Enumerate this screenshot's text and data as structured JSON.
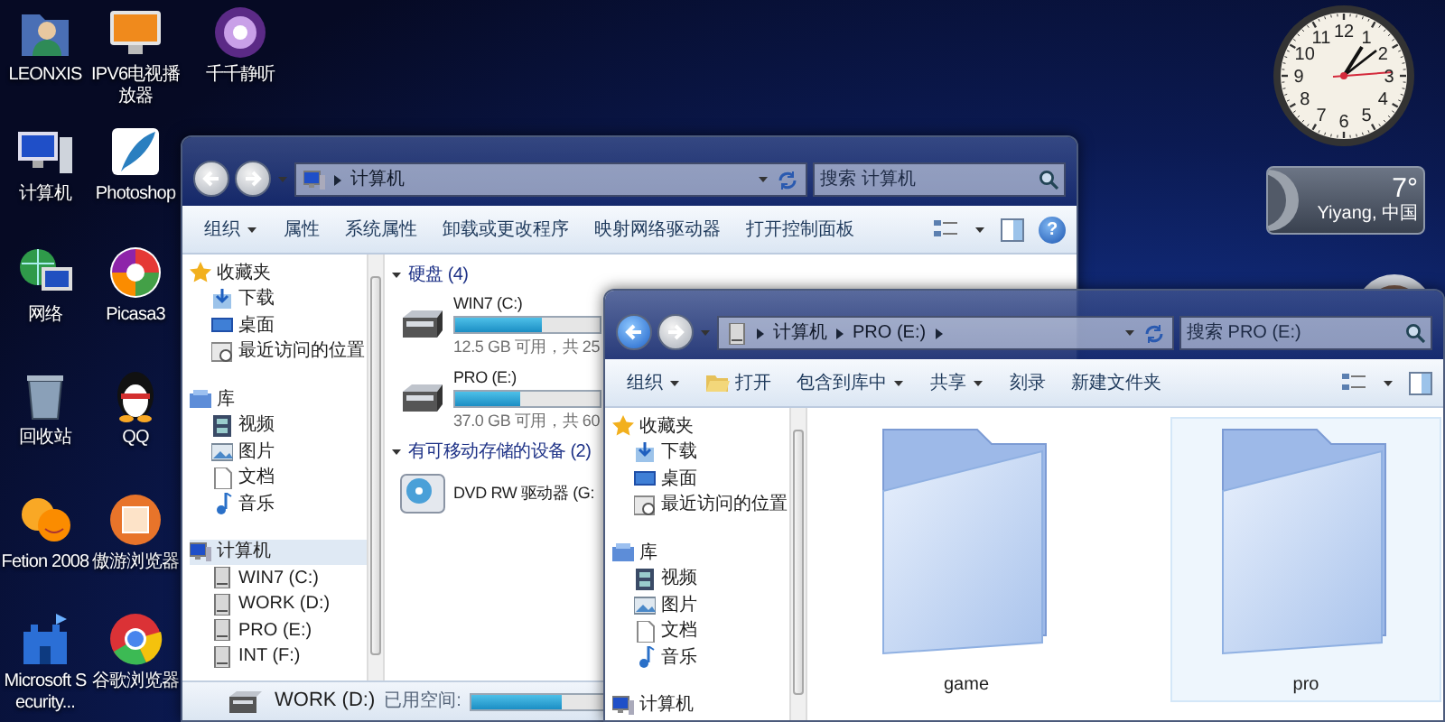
{
  "desktop_icons": [
    {
      "label": "LEONXIS",
      "kind": "userfolder"
    },
    {
      "label": "IPV6电视播放器",
      "kind": "tvplayer"
    },
    {
      "label": "千千静听",
      "kind": "musicplayer"
    },
    {
      "label": "计算机",
      "kind": "computer"
    },
    {
      "label": "Photoshop",
      "kind": "feather"
    },
    {
      "label": "网络",
      "kind": "network"
    },
    {
      "label": "Picasa3",
      "kind": "pinwheel"
    },
    {
      "label": "回收站",
      "kind": "recyclebin"
    },
    {
      "label": "QQ",
      "kind": "penguin"
    },
    {
      "label": "Fetion 2008",
      "kind": "chat"
    },
    {
      "label": "傲游浏览器",
      "kind": "framedapp"
    },
    {
      "label": "Microsoft Security...",
      "kind": "castle"
    },
    {
      "label": "谷歌浏览器",
      "kind": "roundbrowser"
    }
  ],
  "clock": {
    "numerals": [
      "12",
      "11",
      "1",
      "10",
      "2",
      "9",
      "3",
      "8",
      "4",
      "7",
      "5",
      "6"
    ]
  },
  "weather": {
    "temperature": "7°",
    "location": "Yiyang, 中国"
  },
  "windows": [
    {
      "back_enabled": false,
      "forward_enabled": false,
      "address": [
        "计算机"
      ],
      "search": {
        "placeholder": "搜索 计算机"
      },
      "toolbar": [
        {
          "label": "组织",
          "dropdown": true,
          "icon": false
        },
        {
          "label": "属性",
          "dropdown": false,
          "icon": false
        },
        {
          "label": "系统属性",
          "dropdown": false,
          "icon": false
        },
        {
          "label": "卸载或更改程序",
          "dropdown": false,
          "icon": false
        },
        {
          "label": "映射网络驱动器",
          "dropdown": false,
          "icon": false
        },
        {
          "label": "打开控制面板",
          "dropdown": false,
          "icon": false
        }
      ],
      "help": "?",
      "nav": [
        {
          "label": "收藏夹",
          "kind": "favorites",
          "selected": false,
          "children": [
            {
              "label": "下载",
              "kind": "downloads",
              "selected": false
            },
            {
              "label": "桌面",
              "kind": "desktop",
              "selected": false
            },
            {
              "label": "最近访问的位置",
              "kind": "recent",
              "selected": false
            }
          ]
        },
        {
          "label": "库",
          "kind": "library",
          "selected": false,
          "children": [
            {
              "label": "视频",
              "kind": "videos",
              "selected": false
            },
            {
              "label": "图片",
              "kind": "pictures",
              "selected": false
            },
            {
              "label": "文档",
              "kind": "documents",
              "selected": false
            },
            {
              "label": "音乐",
              "kind": "music",
              "selected": false
            }
          ]
        },
        {
          "label": "计算机",
          "kind": "computer",
          "selected": true,
          "children": [
            {
              "label": "WIN7 (C:)",
              "kind": "drive",
              "selected": false
            },
            {
              "label": "WORK (D:)",
              "kind": "drive",
              "selected": false
            },
            {
              "label": "PRO (E:)",
              "kind": "drive",
              "selected": false
            },
            {
              "label": "INT (F:)",
              "kind": "drive",
              "selected": false
            }
          ]
        }
      ],
      "groups": [
        {
          "title": "硬盘 (4)",
          "expanded": true,
          "drives": [
            {
              "kind": "disk",
              "name": "WIN7 (C:)",
              "level": 0.6,
              "free": "12.5 GB 可用，共 25"
            },
            {
              "kind": "disk",
              "name": "PRO (E:)",
              "level": 0.45,
              "free": "37.0 GB 可用，共 60"
            }
          ]
        },
        {
          "title": "有可移动存储的设备 (2)",
          "expanded": true,
          "drives": [
            {
              "kind": "dvd",
              "name": "DVD RW 驱动器 (G:"
            }
          ]
        }
      ],
      "details": {
        "name": "WORK (D:)",
        "label": "已用空间:",
        "level": 0.6
      }
    },
    {
      "back_enabled": true,
      "forward_enabled": false,
      "address": [
        "计算机",
        "PRO (E:)"
      ],
      "search": {
        "placeholder": "搜索 PRO (E:)"
      },
      "toolbar": [
        {
          "label": "组织",
          "dropdown": true,
          "icon": false
        },
        {
          "label": "打开",
          "dropdown": false,
          "icon": true
        },
        {
          "label": "包含到库中",
          "dropdown": true,
          "icon": false
        },
        {
          "label": "共享",
          "dropdown": true,
          "icon": false
        },
        {
          "label": "刻录",
          "dropdown": false,
          "icon": false
        },
        {
          "label": "新建文件夹",
          "dropdown": false,
          "icon": false
        }
      ],
      "nav": [
        {
          "label": "收藏夹",
          "kind": "favorites",
          "selected": false,
          "children": [
            {
              "label": "下载",
              "kind": "downloads",
              "selected": false
            },
            {
              "label": "桌面",
              "kind": "desktop",
              "selected": false
            },
            {
              "label": "最近访问的位置",
              "kind": "recent",
              "selected": false
            }
          ]
        },
        {
          "label": "库",
          "kind": "library",
          "selected": false,
          "children": [
            {
              "label": "视频",
              "kind": "videos",
              "selected": false
            },
            {
              "label": "图片",
              "kind": "pictures",
              "selected": false
            },
            {
              "label": "文档",
              "kind": "documents",
              "selected": false
            },
            {
              "label": "音乐",
              "kind": "music",
              "selected": false
            }
          ]
        },
        {
          "label": "计算机",
          "kind": "computer",
          "selected": false
        }
      ],
      "folders": [
        {
          "label": "game",
          "selected": false
        },
        {
          "label": "pro",
          "selected": true
        }
      ]
    }
  ]
}
